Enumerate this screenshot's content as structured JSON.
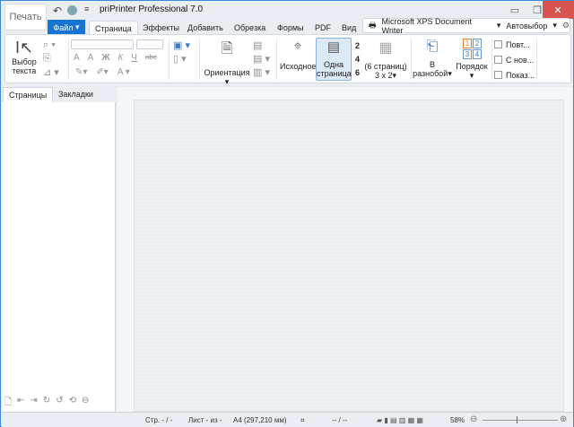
{
  "title": "priPrinter Professional 7.0",
  "print_button": "Печать",
  "file_menu": "Файл",
  "tabs": [
    "Страница",
    "Эффекты",
    "Добавить",
    "Обрезка",
    "Формы",
    "PDF",
    "Вид"
  ],
  "active_tab": "Страница",
  "printer": {
    "name": "Microsoft XPS Document Writer",
    "mode": "Автовыбор"
  },
  "ribbon": {
    "select_text": [
      "Выбор",
      "текста"
    ],
    "font_tools": [
      "A",
      "A",
      "Ж",
      "К",
      "Ч",
      "abc",
      "A"
    ],
    "orientation": "Ориентация",
    "original": "Исходное",
    "one_page": [
      "Одна",
      "страница"
    ],
    "page_numbers": [
      "2",
      "4",
      "6"
    ],
    "six_pages": [
      "(6 страниц)",
      "3 x 2"
    ],
    "shuffle": [
      "В",
      "разнобой"
    ],
    "order": "Порядок",
    "order_numbers": [
      "1",
      "2",
      "3",
      "4"
    ],
    "checkboxes": [
      "Повт...",
      "С нов...",
      "Показ..."
    ]
  },
  "panel_tabs": [
    "Страницы",
    "Закладки"
  ],
  "status": {
    "page": "Стр. - / -",
    "sheet": "Лист - из -",
    "paper": "A4 (297,210 мм)",
    "pos": "-- / --",
    "zoom": "58%"
  },
  "colors": {
    "accent": "#1574d4",
    "close": "#d9534f",
    "border": "#3c8ad8"
  }
}
